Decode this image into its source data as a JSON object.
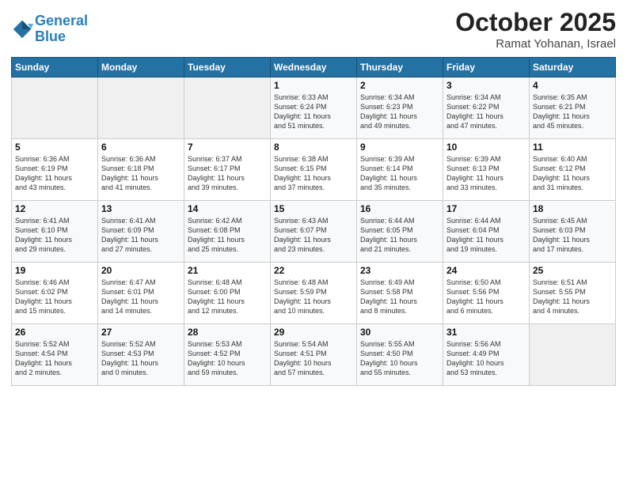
{
  "header": {
    "logo_line1": "General",
    "logo_line2": "Blue",
    "month": "October 2025",
    "location": "Ramat Yohanan, Israel"
  },
  "weekdays": [
    "Sunday",
    "Monday",
    "Tuesday",
    "Wednesday",
    "Thursday",
    "Friday",
    "Saturday"
  ],
  "weeks": [
    [
      {
        "day": "",
        "info": ""
      },
      {
        "day": "",
        "info": ""
      },
      {
        "day": "",
        "info": ""
      },
      {
        "day": "1",
        "info": "Sunrise: 6:33 AM\nSunset: 6:24 PM\nDaylight: 11 hours\nand 51 minutes."
      },
      {
        "day": "2",
        "info": "Sunrise: 6:34 AM\nSunset: 6:23 PM\nDaylight: 11 hours\nand 49 minutes."
      },
      {
        "day": "3",
        "info": "Sunrise: 6:34 AM\nSunset: 6:22 PM\nDaylight: 11 hours\nand 47 minutes."
      },
      {
        "day": "4",
        "info": "Sunrise: 6:35 AM\nSunset: 6:21 PM\nDaylight: 11 hours\nand 45 minutes."
      }
    ],
    [
      {
        "day": "5",
        "info": "Sunrise: 6:36 AM\nSunset: 6:19 PM\nDaylight: 11 hours\nand 43 minutes."
      },
      {
        "day": "6",
        "info": "Sunrise: 6:36 AM\nSunset: 6:18 PM\nDaylight: 11 hours\nand 41 minutes."
      },
      {
        "day": "7",
        "info": "Sunrise: 6:37 AM\nSunset: 6:17 PM\nDaylight: 11 hours\nand 39 minutes."
      },
      {
        "day": "8",
        "info": "Sunrise: 6:38 AM\nSunset: 6:15 PM\nDaylight: 11 hours\nand 37 minutes."
      },
      {
        "day": "9",
        "info": "Sunrise: 6:39 AM\nSunset: 6:14 PM\nDaylight: 11 hours\nand 35 minutes."
      },
      {
        "day": "10",
        "info": "Sunrise: 6:39 AM\nSunset: 6:13 PM\nDaylight: 11 hours\nand 33 minutes."
      },
      {
        "day": "11",
        "info": "Sunrise: 6:40 AM\nSunset: 6:12 PM\nDaylight: 11 hours\nand 31 minutes."
      }
    ],
    [
      {
        "day": "12",
        "info": "Sunrise: 6:41 AM\nSunset: 6:10 PM\nDaylight: 11 hours\nand 29 minutes."
      },
      {
        "day": "13",
        "info": "Sunrise: 6:41 AM\nSunset: 6:09 PM\nDaylight: 11 hours\nand 27 minutes."
      },
      {
        "day": "14",
        "info": "Sunrise: 6:42 AM\nSunset: 6:08 PM\nDaylight: 11 hours\nand 25 minutes."
      },
      {
        "day": "15",
        "info": "Sunrise: 6:43 AM\nSunset: 6:07 PM\nDaylight: 11 hours\nand 23 minutes."
      },
      {
        "day": "16",
        "info": "Sunrise: 6:44 AM\nSunset: 6:05 PM\nDaylight: 11 hours\nand 21 minutes."
      },
      {
        "day": "17",
        "info": "Sunrise: 6:44 AM\nSunset: 6:04 PM\nDaylight: 11 hours\nand 19 minutes."
      },
      {
        "day": "18",
        "info": "Sunrise: 6:45 AM\nSunset: 6:03 PM\nDaylight: 11 hours\nand 17 minutes."
      }
    ],
    [
      {
        "day": "19",
        "info": "Sunrise: 6:46 AM\nSunset: 6:02 PM\nDaylight: 11 hours\nand 15 minutes."
      },
      {
        "day": "20",
        "info": "Sunrise: 6:47 AM\nSunset: 6:01 PM\nDaylight: 11 hours\nand 14 minutes."
      },
      {
        "day": "21",
        "info": "Sunrise: 6:48 AM\nSunset: 6:00 PM\nDaylight: 11 hours\nand 12 minutes."
      },
      {
        "day": "22",
        "info": "Sunrise: 6:48 AM\nSunset: 5:59 PM\nDaylight: 11 hours\nand 10 minutes."
      },
      {
        "day": "23",
        "info": "Sunrise: 6:49 AM\nSunset: 5:58 PM\nDaylight: 11 hours\nand 8 minutes."
      },
      {
        "day": "24",
        "info": "Sunrise: 6:50 AM\nSunset: 5:56 PM\nDaylight: 11 hours\nand 6 minutes."
      },
      {
        "day": "25",
        "info": "Sunrise: 6:51 AM\nSunset: 5:55 PM\nDaylight: 11 hours\nand 4 minutes."
      }
    ],
    [
      {
        "day": "26",
        "info": "Sunrise: 5:52 AM\nSunset: 4:54 PM\nDaylight: 11 hours\nand 2 minutes."
      },
      {
        "day": "27",
        "info": "Sunrise: 5:52 AM\nSunset: 4:53 PM\nDaylight: 11 hours\nand 0 minutes."
      },
      {
        "day": "28",
        "info": "Sunrise: 5:53 AM\nSunset: 4:52 PM\nDaylight: 10 hours\nand 59 minutes."
      },
      {
        "day": "29",
        "info": "Sunrise: 5:54 AM\nSunset: 4:51 PM\nDaylight: 10 hours\nand 57 minutes."
      },
      {
        "day": "30",
        "info": "Sunrise: 5:55 AM\nSunset: 4:50 PM\nDaylight: 10 hours\nand 55 minutes."
      },
      {
        "day": "31",
        "info": "Sunrise: 5:56 AM\nSunset: 4:49 PM\nDaylight: 10 hours\nand 53 minutes."
      },
      {
        "day": "",
        "info": ""
      }
    ]
  ]
}
